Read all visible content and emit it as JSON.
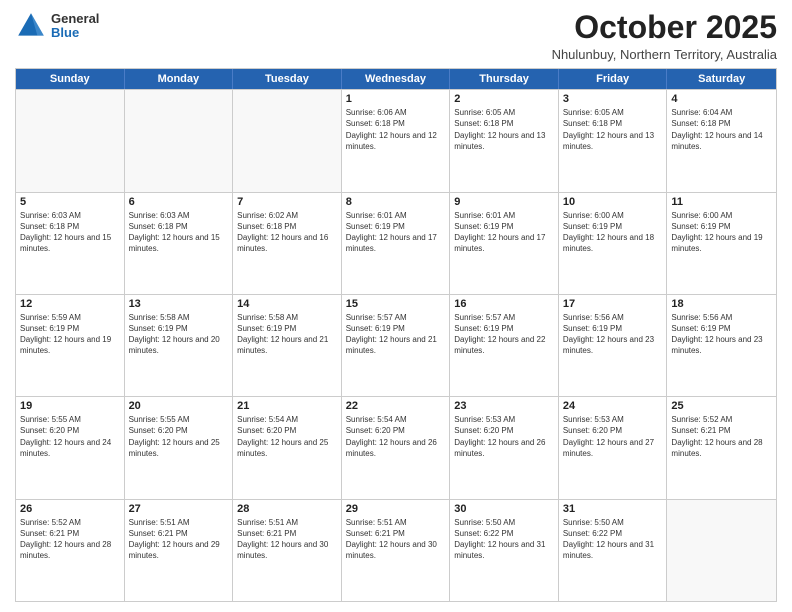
{
  "logo": {
    "general": "General",
    "blue": "Blue"
  },
  "title": "October 2025",
  "subtitle": "Nhulunbuy, Northern Territory, Australia",
  "days_of_week": [
    "Sunday",
    "Monday",
    "Tuesday",
    "Wednesday",
    "Thursday",
    "Friday",
    "Saturday"
  ],
  "weeks": [
    [
      {
        "day": "",
        "empty": true
      },
      {
        "day": "",
        "empty": true
      },
      {
        "day": "",
        "empty": true
      },
      {
        "day": "1",
        "sunrise": "6:06 AM",
        "sunset": "6:18 PM",
        "daylight": "12 hours and 12 minutes."
      },
      {
        "day": "2",
        "sunrise": "6:05 AM",
        "sunset": "6:18 PM",
        "daylight": "12 hours and 13 minutes."
      },
      {
        "day": "3",
        "sunrise": "6:05 AM",
        "sunset": "6:18 PM",
        "daylight": "12 hours and 13 minutes."
      },
      {
        "day": "4",
        "sunrise": "6:04 AM",
        "sunset": "6:18 PM",
        "daylight": "12 hours and 14 minutes."
      }
    ],
    [
      {
        "day": "5",
        "sunrise": "6:03 AM",
        "sunset": "6:18 PM",
        "daylight": "12 hours and 15 minutes."
      },
      {
        "day": "6",
        "sunrise": "6:03 AM",
        "sunset": "6:18 PM",
        "daylight": "12 hours and 15 minutes."
      },
      {
        "day": "7",
        "sunrise": "6:02 AM",
        "sunset": "6:18 PM",
        "daylight": "12 hours and 16 minutes."
      },
      {
        "day": "8",
        "sunrise": "6:01 AM",
        "sunset": "6:19 PM",
        "daylight": "12 hours and 17 minutes."
      },
      {
        "day": "9",
        "sunrise": "6:01 AM",
        "sunset": "6:19 PM",
        "daylight": "12 hours and 17 minutes."
      },
      {
        "day": "10",
        "sunrise": "6:00 AM",
        "sunset": "6:19 PM",
        "daylight": "12 hours and 18 minutes."
      },
      {
        "day": "11",
        "sunrise": "6:00 AM",
        "sunset": "6:19 PM",
        "daylight": "12 hours and 19 minutes."
      }
    ],
    [
      {
        "day": "12",
        "sunrise": "5:59 AM",
        "sunset": "6:19 PM",
        "daylight": "12 hours and 19 minutes."
      },
      {
        "day": "13",
        "sunrise": "5:58 AM",
        "sunset": "6:19 PM",
        "daylight": "12 hours and 20 minutes."
      },
      {
        "day": "14",
        "sunrise": "5:58 AM",
        "sunset": "6:19 PM",
        "daylight": "12 hours and 21 minutes."
      },
      {
        "day": "15",
        "sunrise": "5:57 AM",
        "sunset": "6:19 PM",
        "daylight": "12 hours and 21 minutes."
      },
      {
        "day": "16",
        "sunrise": "5:57 AM",
        "sunset": "6:19 PM",
        "daylight": "12 hours and 22 minutes."
      },
      {
        "day": "17",
        "sunrise": "5:56 AM",
        "sunset": "6:19 PM",
        "daylight": "12 hours and 23 minutes."
      },
      {
        "day": "18",
        "sunrise": "5:56 AM",
        "sunset": "6:19 PM",
        "daylight": "12 hours and 23 minutes."
      }
    ],
    [
      {
        "day": "19",
        "sunrise": "5:55 AM",
        "sunset": "6:20 PM",
        "daylight": "12 hours and 24 minutes."
      },
      {
        "day": "20",
        "sunrise": "5:55 AM",
        "sunset": "6:20 PM",
        "daylight": "12 hours and 25 minutes."
      },
      {
        "day": "21",
        "sunrise": "5:54 AM",
        "sunset": "6:20 PM",
        "daylight": "12 hours and 25 minutes."
      },
      {
        "day": "22",
        "sunrise": "5:54 AM",
        "sunset": "6:20 PM",
        "daylight": "12 hours and 26 minutes."
      },
      {
        "day": "23",
        "sunrise": "5:53 AM",
        "sunset": "6:20 PM",
        "daylight": "12 hours and 26 minutes."
      },
      {
        "day": "24",
        "sunrise": "5:53 AM",
        "sunset": "6:20 PM",
        "daylight": "12 hours and 27 minutes."
      },
      {
        "day": "25",
        "sunrise": "5:52 AM",
        "sunset": "6:21 PM",
        "daylight": "12 hours and 28 minutes."
      }
    ],
    [
      {
        "day": "26",
        "sunrise": "5:52 AM",
        "sunset": "6:21 PM",
        "daylight": "12 hours and 28 minutes."
      },
      {
        "day": "27",
        "sunrise": "5:51 AM",
        "sunset": "6:21 PM",
        "daylight": "12 hours and 29 minutes."
      },
      {
        "day": "28",
        "sunrise": "5:51 AM",
        "sunset": "6:21 PM",
        "daylight": "12 hours and 30 minutes."
      },
      {
        "day": "29",
        "sunrise": "5:51 AM",
        "sunset": "6:21 PM",
        "daylight": "12 hours and 30 minutes."
      },
      {
        "day": "30",
        "sunrise": "5:50 AM",
        "sunset": "6:22 PM",
        "daylight": "12 hours and 31 minutes."
      },
      {
        "day": "31",
        "sunrise": "5:50 AM",
        "sunset": "6:22 PM",
        "daylight": "12 hours and 31 minutes."
      },
      {
        "day": "",
        "empty": true
      }
    ]
  ]
}
